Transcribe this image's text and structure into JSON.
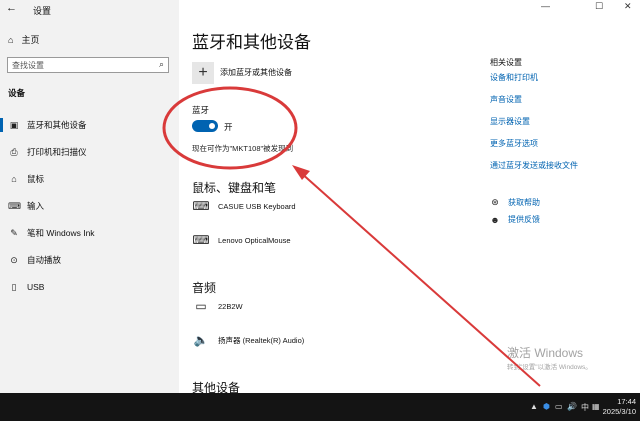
{
  "window": {
    "title": "设置",
    "back_glyph": "←",
    "minimize_glyph": "—",
    "maximize_glyph": "☐",
    "close_glyph": "✕"
  },
  "sidebar": {
    "home_label": "主页",
    "search_placeholder": "查找设置",
    "section_label": "设备",
    "items": [
      {
        "label": "蓝牙和其他设备",
        "icon": "bluetooth-devices-icon",
        "glyph": "▣",
        "active": true
      },
      {
        "label": "打印机和扫描仪",
        "icon": "printer-icon",
        "glyph": "⎙"
      },
      {
        "label": "鼠标",
        "icon": "mouse-icon",
        "glyph": "⌂"
      },
      {
        "label": "输入",
        "icon": "keyboard-icon",
        "glyph": "⌨"
      },
      {
        "label": "笔和 Windows Ink",
        "icon": "pen-icon",
        "glyph": "✎"
      },
      {
        "label": "自动播放",
        "icon": "autoplay-icon",
        "glyph": "⊙"
      },
      {
        "label": "USB",
        "icon": "usb-icon",
        "glyph": "▯"
      }
    ]
  },
  "main": {
    "title": "蓝牙和其他设备",
    "add_device_label": "添加蓝牙或其他设备",
    "add_glyph": "+",
    "bluetooth_label": "蓝牙",
    "bluetooth_state": "开",
    "bluetooth_on": true,
    "discoverable_text": "现在可作为\"MKT108\"被发现到",
    "mouse_keyboard_heading": "鼠标、键盘和笔",
    "input_devices": [
      {
        "name": "CASUE USB Keyboard",
        "icon": "keyboard-icon",
        "glyph": "⌨"
      },
      {
        "name": "Lenovo OpticalMouse",
        "icon": "keyboard-icon",
        "glyph": "⌨"
      }
    ],
    "audio_heading": "音频",
    "audio_devices": [
      {
        "name": "22B2W",
        "icon": "monitor-icon",
        "glyph": "▭"
      },
      {
        "name": "扬声器 (Realtek(R) Audio)",
        "icon": "speaker-icon",
        "glyph": "🔈"
      }
    ],
    "other_heading": "其他设备"
  },
  "related": {
    "heading": "相关设置",
    "links": [
      "设备和打印机",
      "声音设置",
      "显示器设置",
      "更多蓝牙选项",
      "通过蓝牙发送或接收文件"
    ],
    "help": [
      {
        "label": "获取帮助",
        "icon": "help-icon",
        "glyph": "⊛"
      },
      {
        "label": "提供反馈",
        "icon": "feedback-icon",
        "glyph": "☻"
      }
    ]
  },
  "watermark": {
    "line1": "激活 Windows",
    "line2": "转到\"设置\"以激活 Windows。"
  },
  "taskbar": {
    "tray_glyphs": [
      "▲",
      "⬢",
      "▭",
      "🔊",
      "中",
      "▦"
    ],
    "time": "17:44",
    "date": "2025/3/10"
  },
  "annotation": {
    "color": "#d93a3a"
  }
}
